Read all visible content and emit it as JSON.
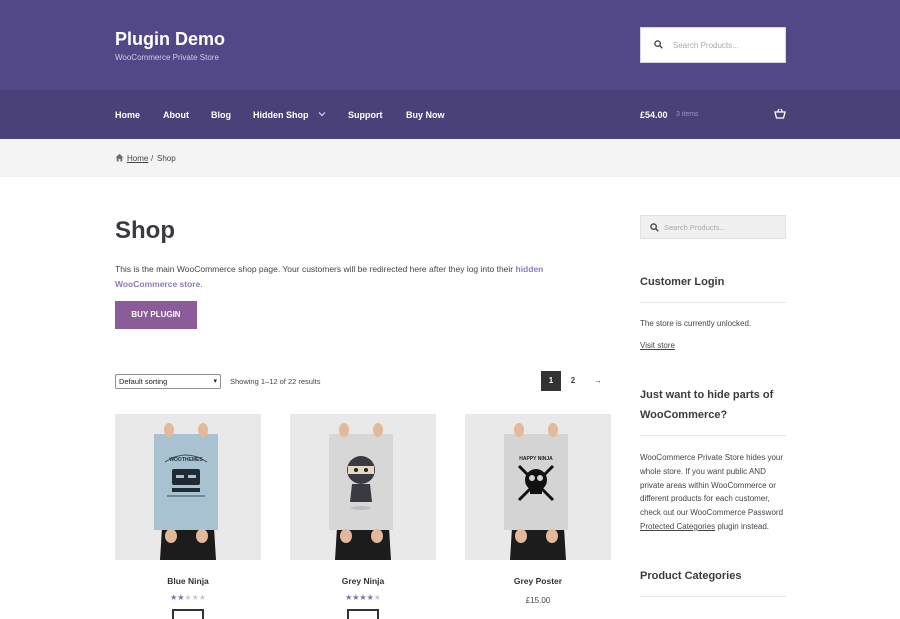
{
  "header": {
    "site_title": "Plugin Demo",
    "site_description": "WooCommerce Private Store",
    "search_placeholder": "Search Products...",
    "colors": {
      "top": "#524888",
      "nav": "#4a4178"
    }
  },
  "nav": {
    "items": [
      "Home",
      "About",
      "Blog",
      "Hidden Shop",
      "Support",
      "Buy Now"
    ],
    "cart_total": "£54.00",
    "cart_items": "3 items"
  },
  "breadcrumb": {
    "home": "Home",
    "separator": "/",
    "current": "Shop"
  },
  "main": {
    "title": "Shop",
    "intro_text": "This is the main WooCommerce shop page. Your customers will be redirected here after they log into their",
    "intro_link_line1": "hidden",
    "intro_link_line2": "WooCommerce store",
    "intro_end": ".",
    "buy_button": "BUY PLUGIN",
    "sorting_selected": "Default sorting",
    "results_text": "Showing 1–12 of 22 results",
    "pagination": {
      "current": "1",
      "next_page": "2",
      "next_arrow": "→"
    },
    "products": [
      {
        "name": "Blue Ninja",
        "rating": 2,
        "poster_text": "WOOTHEMES"
      },
      {
        "name": "Grey Ninja",
        "rating": 4
      },
      {
        "name": "Grey Poster",
        "price": "£15.00",
        "poster_text": "HAPPY NINJA"
      }
    ]
  },
  "sidebar": {
    "search_placeholder": "Search Products...",
    "login_title": "Customer Login",
    "login_status": "The store is currently unlocked.",
    "visit_store": "Visit store",
    "hide_title_1": "Just want to hide parts of",
    "hide_title_2": "WooCommerce?",
    "hide_text_1": "WooCommerce Private Store hides your",
    "hide_text_2": "whole store. If you want public AND",
    "hide_text_3": "private areas within WooCommerce or",
    "hide_text_4": "different products for each customer,",
    "hide_text_5": "check out our WooCommerce Password",
    "hide_link": "Protected Categories",
    "hide_text_6": "plugin instead.",
    "categories_title": "Product Categories"
  }
}
